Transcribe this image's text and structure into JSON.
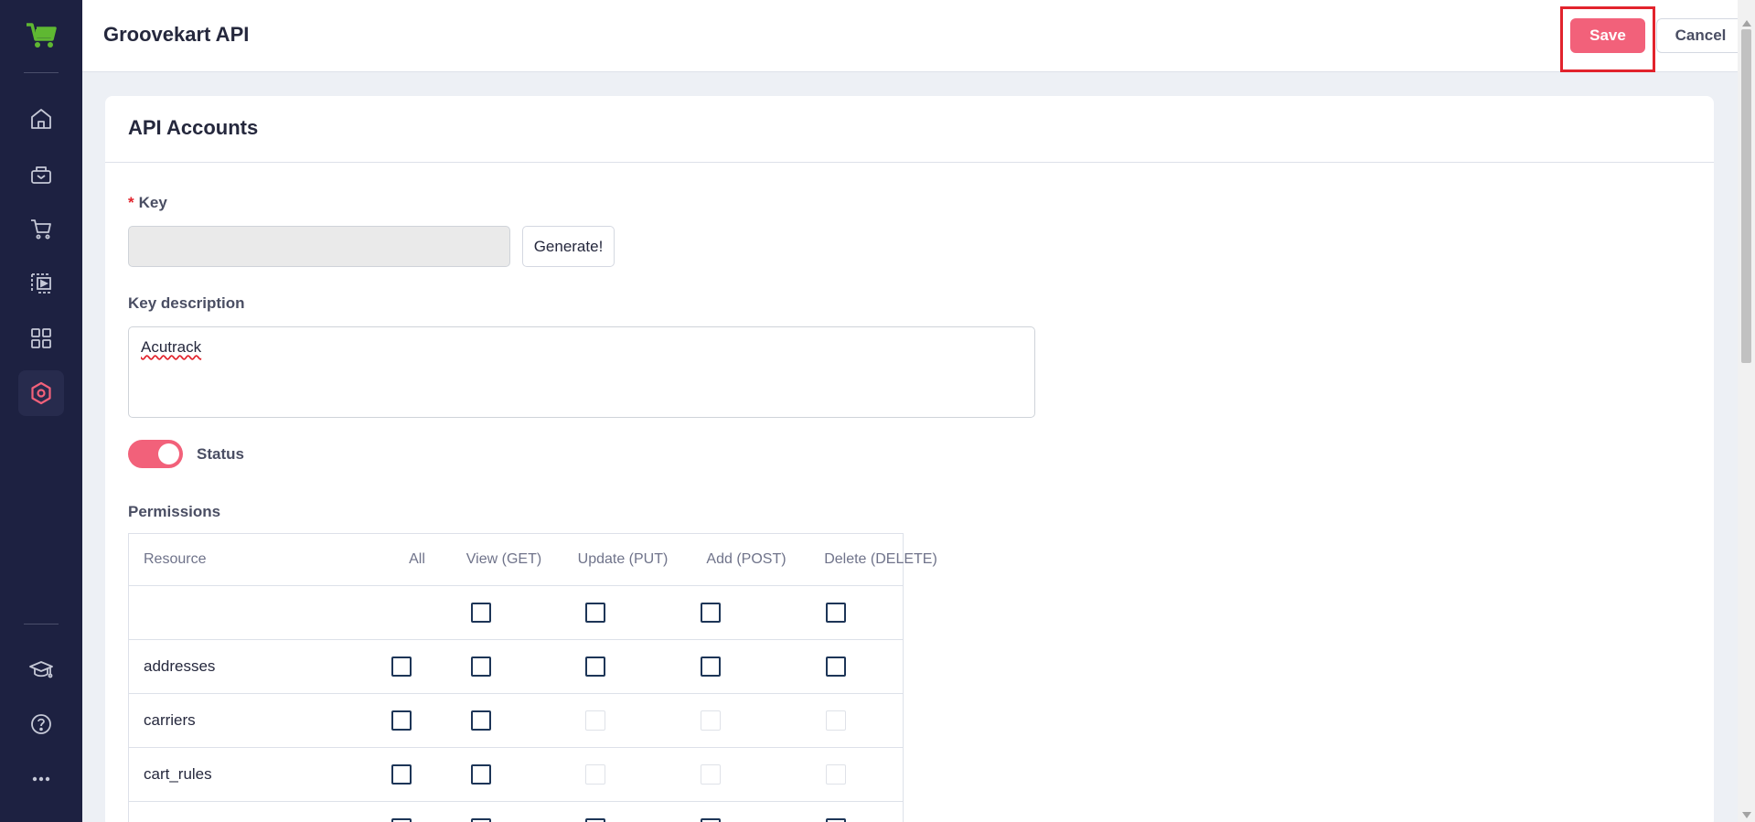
{
  "header": {
    "title": "Groovekart API",
    "save_label": "Save",
    "cancel_label": "Cancel"
  },
  "card": {
    "title": "API Accounts",
    "key": {
      "required_mark": "*",
      "label": "Key",
      "value": "",
      "generate_label": "Generate!"
    },
    "description": {
      "label": "Key description",
      "value": "Acutrack"
    },
    "status": {
      "label": "Status",
      "enabled": true
    },
    "permissions": {
      "label": "Permissions",
      "columns": [
        "Resource",
        "All",
        "View (GET)",
        "Update (PUT)",
        "Add (POST)",
        "Delete (DELETE)"
      ],
      "rows": [
        {
          "resource": "",
          "all": null,
          "get": "unchecked",
          "put": "unchecked",
          "post": "unchecked",
          "delete": "unchecked"
        },
        {
          "resource": "addresses",
          "all": "unchecked",
          "get": "unchecked",
          "put": "unchecked",
          "post": "unchecked",
          "delete": "unchecked"
        },
        {
          "resource": "carriers",
          "all": "unchecked",
          "get": "unchecked",
          "put": "disabled",
          "post": "disabled",
          "delete": "disabled"
        },
        {
          "resource": "cart_rules",
          "all": "unchecked",
          "get": "unchecked",
          "put": "disabled",
          "post": "disabled",
          "delete": "disabled"
        },
        {
          "resource": "",
          "all": "unchecked",
          "get": "unchecked",
          "put": "unchecked",
          "post": "unchecked",
          "delete": "unchecked"
        }
      ]
    }
  },
  "sidebar": {
    "top_icons": [
      "home-icon",
      "catalog-icon",
      "cart-icon",
      "marketing-icon",
      "apps-icon",
      "settings-icon"
    ],
    "bottom_icons": [
      "learning-icon",
      "help-icon",
      "more-icon"
    ],
    "active": "settings-icon"
  },
  "colors": {
    "sidebar": "#1d2141",
    "accent": "#f2617a",
    "highlight": "#e2232c",
    "logo": "#5fb832"
  }
}
